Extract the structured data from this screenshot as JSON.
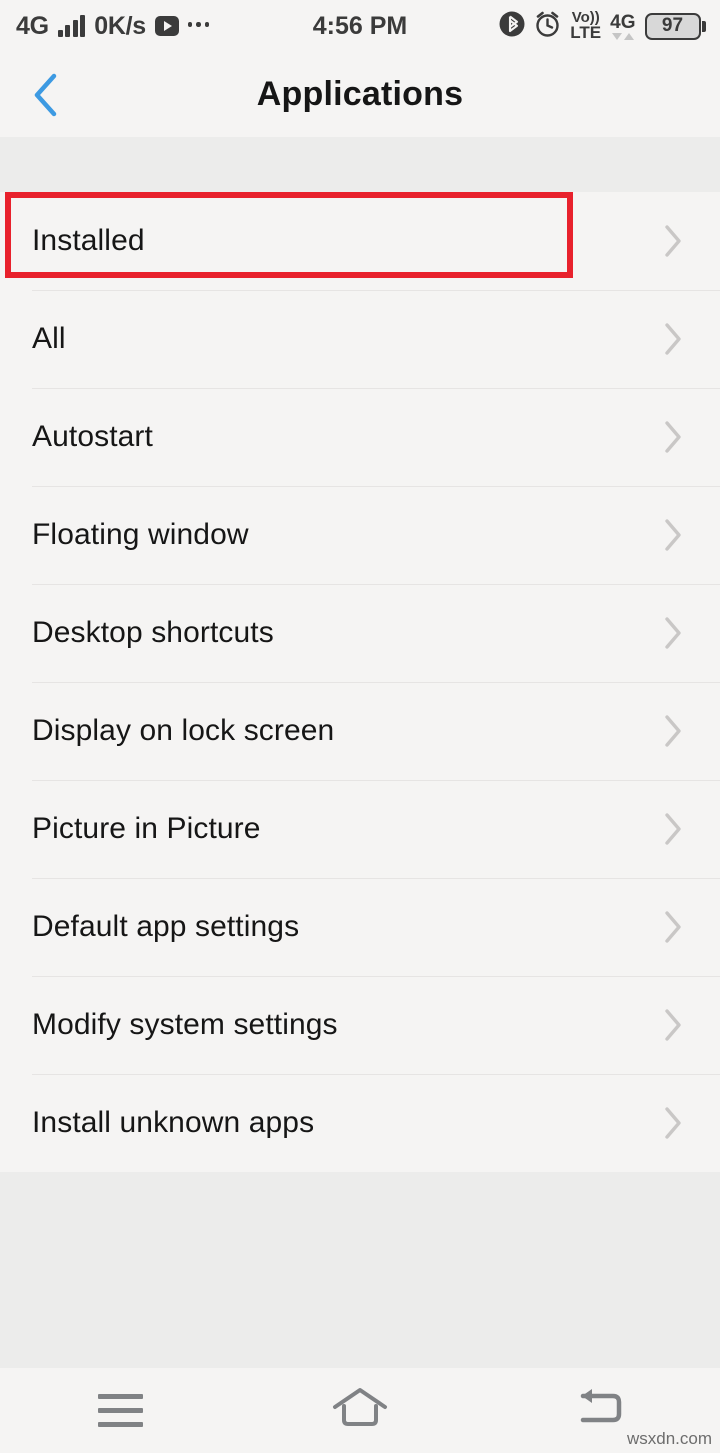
{
  "status_bar": {
    "network_label": "4G",
    "signal_bars": 4,
    "data_rate": "0K/s",
    "media_icon": "play-badge-icon",
    "overflow_icon": "ellipsis-icon",
    "time": "4:56 PM",
    "bluetooth_icon": "bluetooth-icon",
    "alarm_icon": "alarm-clock-icon",
    "volte_top": "Vo))",
    "volte_bottom": "LTE",
    "mobile_network": "4G",
    "battery_level": "97"
  },
  "header": {
    "back_icon": "chevron-left-icon",
    "title": "Applications",
    "accent_color": "#3d9ae2"
  },
  "list": {
    "chevron_icon": "chevron-right-icon",
    "items": [
      {
        "label": "Installed"
      },
      {
        "label": "All"
      },
      {
        "label": "Autostart"
      },
      {
        "label": "Floating window"
      },
      {
        "label": "Desktop shortcuts"
      },
      {
        "label": "Display on lock screen"
      },
      {
        "label": "Picture in Picture"
      },
      {
        "label": "Default app settings"
      },
      {
        "label": "Modify system settings"
      },
      {
        "label": "Install unknown apps"
      }
    ]
  },
  "annotation": {
    "highlight_target": "Installed",
    "color": "#e8212c"
  },
  "navigation_bar": {
    "menu_icon": "menu-hamburger-icon",
    "home_icon": "home-icon",
    "back_icon": "back-arrow-icon"
  },
  "watermark": {
    "text": "wsxdn.com"
  }
}
